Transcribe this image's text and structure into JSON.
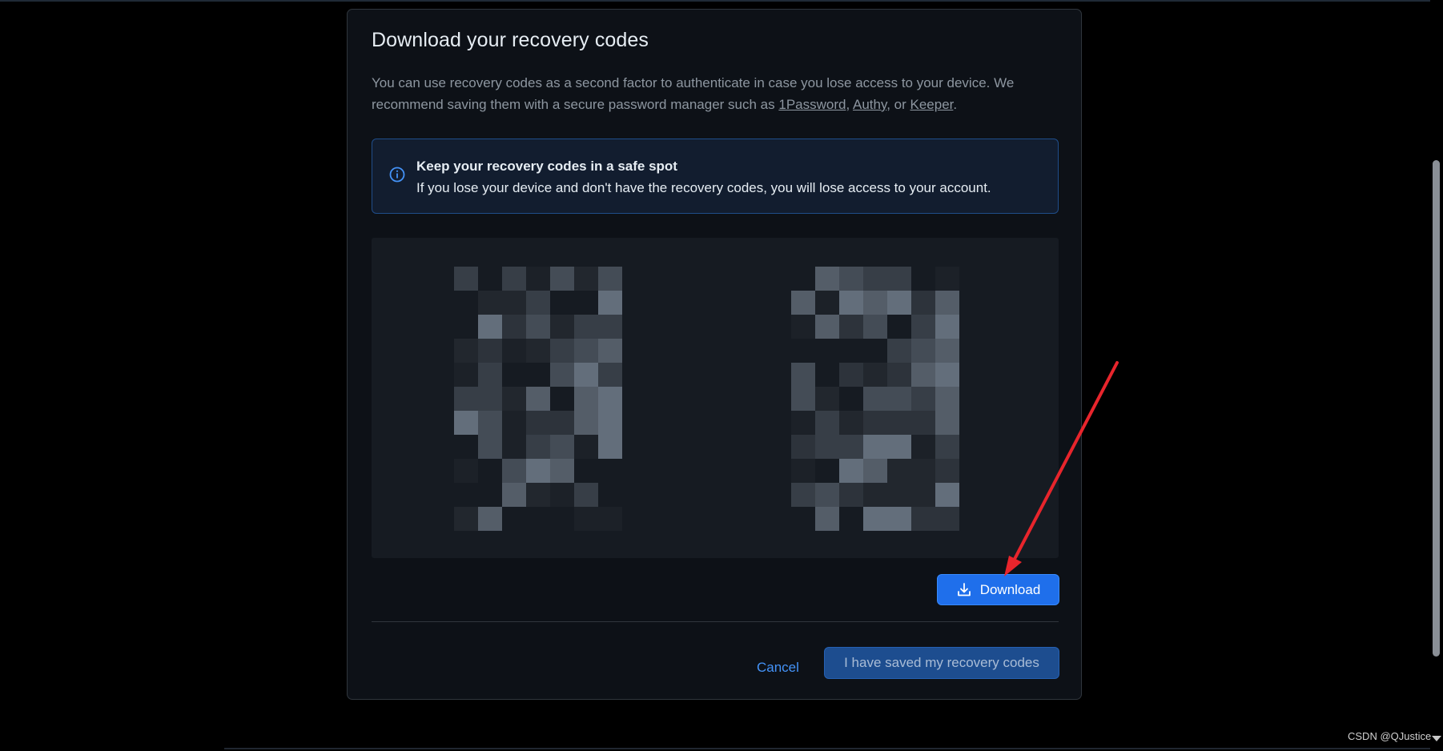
{
  "dialog": {
    "title": "Download your recovery codes",
    "description_prefix": "You can use recovery codes as a second factor to authenticate in case you lose access to your device. We recommend saving them with a secure password manager such as ",
    "links": [
      "1Password",
      "Authy",
      "Keeper"
    ],
    "sep1": ", ",
    "sep2": ", or ",
    "description_suffix": "."
  },
  "flash": {
    "icon": "info-icon",
    "title": "Keep your recovery codes in a safe spot",
    "body": "If you lose your device and don't have the recovery codes, you will lose access to your account."
  },
  "codes": {
    "state": "pixelated / obscured"
  },
  "buttons": {
    "download_label": "Download",
    "download_icon": "download-icon",
    "cancel_label": "Cancel",
    "saved_label": "I have saved my recovery codes"
  },
  "colors": {
    "accent": "#1f6feb",
    "link": "#4493f8",
    "annotation_arrow": "#e8252c"
  },
  "watermark": "CSDN @QJustice"
}
